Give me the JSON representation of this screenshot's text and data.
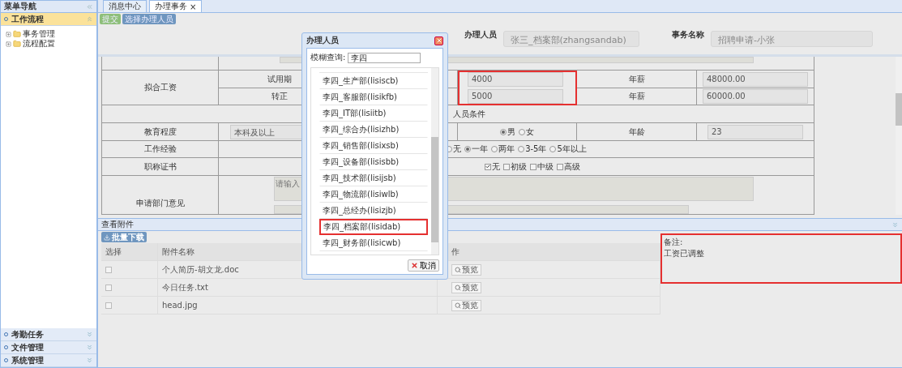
{
  "sidebar": {
    "title": "菜单导航",
    "sections": [
      {
        "label": "工作流程",
        "expanded": true,
        "items": [
          {
            "label": "事务管理"
          },
          {
            "label": "流程配置"
          }
        ]
      },
      {
        "label": "考勤任务",
        "expanded": false
      },
      {
        "label": "文件管理",
        "expanded": false
      },
      {
        "label": "系统管理",
        "expanded": false
      }
    ]
  },
  "tabs": [
    {
      "label": "消息中心",
      "selected": false
    },
    {
      "label": "办理事务",
      "selected": true,
      "close": "×"
    }
  ],
  "toolbar": [
    {
      "label": "提交",
      "kind": "submit"
    },
    {
      "label": "选择办理人员",
      "kind": "select"
    }
  ],
  "header_fields": [
    {
      "label": "办理人员",
      "value": "张三_档案部(zhangsandab)",
      "disabled": true
    },
    {
      "label": "事务名称",
      "value": "招聘申请-小张",
      "disabled": true
    }
  ],
  "form": {
    "salary": {
      "label": "拟合工资",
      "highlighted": true,
      "rows": [
        {
          "label": "试用期",
          "monthly": "4000",
          "annual_label": "年薪",
          "annual": "48000.00"
        },
        {
          "label": "转正",
          "monthly": "5000",
          "annual_label": "年薪",
          "annual": "60000.00"
        }
      ]
    },
    "conditions_heading": "人员条件",
    "education": {
      "label": "教育程度",
      "value": "本科及以上"
    },
    "gender": [
      {
        "label": "男",
        "selected": true
      },
      {
        "label": "女",
        "selected": false
      }
    ],
    "age": {
      "label": "年龄",
      "value": "23"
    },
    "experience": {
      "label": "工作经验",
      "options": [
        {
          "label": "无",
          "selected": false
        },
        {
          "label": "一年",
          "selected": true
        },
        {
          "label": "两年",
          "selected": false
        },
        {
          "label": "3-5年",
          "selected": false
        },
        {
          "label": "5年以上",
          "selected": false
        }
      ]
    },
    "certificate": {
      "label": "职称证书",
      "options": [
        {
          "label": "无",
          "checked": true
        },
        {
          "label": "初级",
          "checked": false
        },
        {
          "label": "中级",
          "checked": false
        },
        {
          "label": "高级",
          "checked": false
        }
      ]
    },
    "opinion": {
      "label": "申请部门意见",
      "placeholder": "请输入"
    }
  },
  "attachments": {
    "title": "查看附件",
    "download": "批量下载",
    "columns": [
      "选择",
      "附件名称",
      "作"
    ],
    "rows": [
      {
        "name": "个人简历-胡文龙.doc",
        "checked": false,
        "action": "预览"
      },
      {
        "name": "今日任务.txt",
        "checked": false,
        "action": "预览"
      },
      {
        "name": "head.jpg",
        "checked": false,
        "action": "预览"
      }
    ],
    "remark": {
      "label": "备注:",
      "value": "工资已调整",
      "highlighted": true
    }
  },
  "dialog": {
    "title": "办理人员",
    "search_label": "模糊查询:",
    "search_value": "李四",
    "items": [
      {
        "label": "李四_生产部(lisiscb)",
        "selected": false
      },
      {
        "label": "李四_客服部(lisikfb)",
        "selected": false
      },
      {
        "label": "李四_IT部(lisiitb)",
        "selected": false
      },
      {
        "label": "李四_综合办(lisizhb)",
        "selected": false
      },
      {
        "label": "李四_销售部(lisixsb)",
        "selected": false
      },
      {
        "label": "李四_设备部(lisisbb)",
        "selected": false
      },
      {
        "label": "李四_技术部(lisijsb)",
        "selected": false
      },
      {
        "label": "李四_物流部(lisiwlb)",
        "selected": false
      },
      {
        "label": "李四_总经办(lisizjb)",
        "selected": false
      },
      {
        "label": "李四_档案部(lisidab)",
        "selected": true
      },
      {
        "label": "李四_财务部(lisicwb)",
        "selected": false
      }
    ],
    "cancel": "取消"
  }
}
